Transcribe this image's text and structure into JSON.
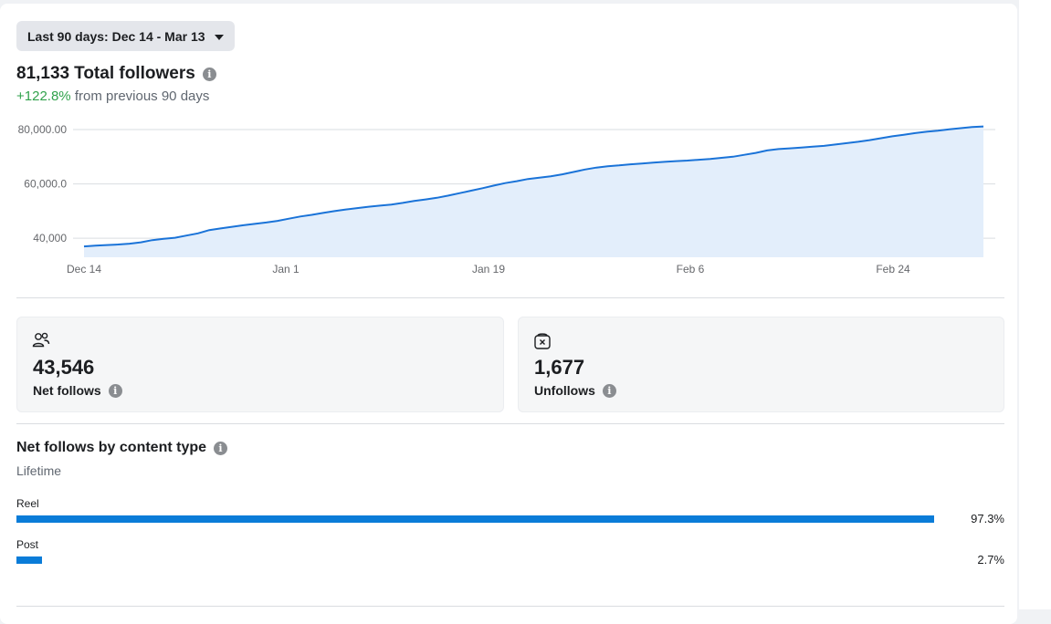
{
  "date_range": {
    "label": "Last 90 days: Dec 14 - Mar 13"
  },
  "summary": {
    "total_value": "81,133",
    "total_label": "Total followers",
    "change_value": "+122.8%",
    "change_text": "from previous 90 days"
  },
  "colors": {
    "line": "#1a73d8",
    "area": "#e3eefb",
    "positive": "#31a24c",
    "bar": "#0a7cd8"
  },
  "chart_data": {
    "type": "area",
    "x_tick_labels": [
      "Dec 14",
      "Jan 1",
      "Jan 19",
      "Feb 6",
      "Feb 24"
    ],
    "y_tick_labels": [
      "40,000",
      "60,000.0",
      "80,000.00"
    ],
    "y_ticks": [
      40000,
      60000,
      80000
    ],
    "ylim": [
      33000,
      80000
    ],
    "grid": true,
    "series": [
      {
        "values": [
          37000,
          37300,
          37500,
          37700,
          38000,
          38500,
          39300,
          39800,
          40200,
          41000,
          41800,
          43000,
          43600,
          44200,
          44800,
          45300,
          45800,
          46400,
          47200,
          48000,
          48600,
          49300,
          50000,
          50600,
          51100,
          51600,
          52000,
          52400,
          53000,
          53700,
          54300,
          54900,
          55700,
          56600,
          57500,
          58400,
          59400,
          60300,
          61000,
          61800,
          62300,
          62800,
          63500,
          64400,
          65300,
          66000,
          66500,
          66800,
          67200,
          67500,
          67800,
          68100,
          68400,
          68600,
          68900,
          69200,
          69600,
          70000,
          70700,
          71400,
          72300,
          72800,
          73100,
          73400,
          73700,
          74000,
          74500,
          75000,
          75500,
          76100,
          76800,
          77500,
          78100,
          78700,
          79200,
          79600,
          80100,
          80500,
          80900,
          81133
        ]
      }
    ]
  },
  "stats": {
    "net_follows": {
      "value": "43,546",
      "label": "Net follows",
      "icon": "people-icon"
    },
    "unfollows": {
      "value": "1,677",
      "label": "Unfollows",
      "icon": "unfollow-icon"
    }
  },
  "content_type": {
    "title": "Net follows by content type",
    "subtitle": "Lifetime",
    "rows": [
      {
        "label": "Reel",
        "percent": 97.3,
        "percent_label": "97.3%"
      },
      {
        "label": "Post",
        "percent": 2.7,
        "percent_label": "2.7%"
      }
    ]
  }
}
